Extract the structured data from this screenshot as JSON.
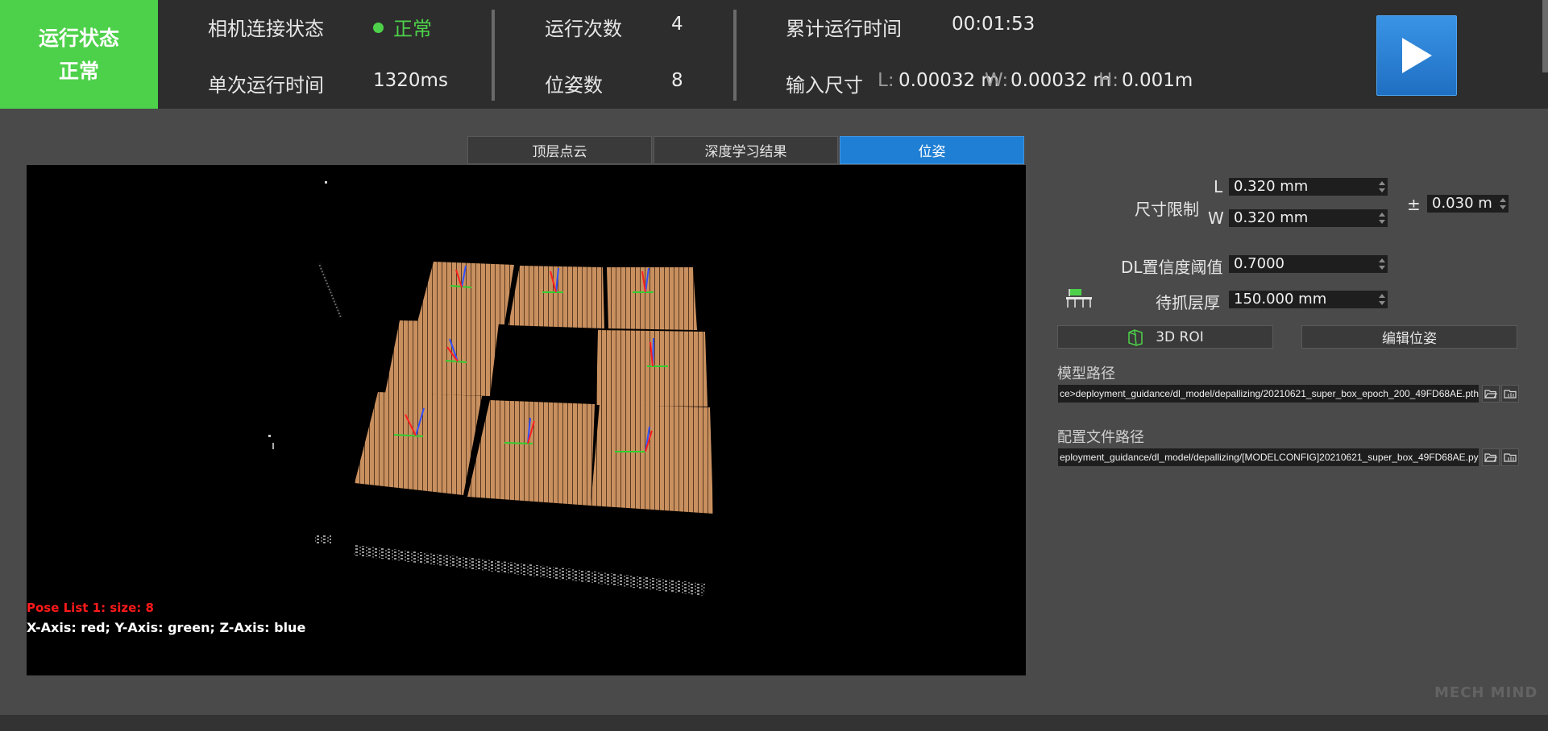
{
  "status": {
    "line1": "运行状态",
    "line2": "正常",
    "color": "#4ed14a"
  },
  "topbar": {
    "camera_label": "相机连接状态",
    "camera_value": "正常",
    "single_run_label": "单次运行时间",
    "single_run_value": "1320ms",
    "run_count_label": "运行次数",
    "run_count_value": "4",
    "pose_count_label": "位姿数",
    "pose_count_value": "8",
    "cum_time_label": "累计运行时间",
    "cum_time_value": "00:01:53",
    "input_size_label": "输入尺寸",
    "size_L_label": "L:",
    "size_L_value": "0.00032 m",
    "size_W_label": "W:",
    "size_W_value": "0.00032 m",
    "size_H_label": "H:",
    "size_H_value": "0.001m",
    "play_icon": "play-icon"
  },
  "tabs": [
    {
      "label": "顶层点云",
      "active": false
    },
    {
      "label": "深度学习结果",
      "active": false
    },
    {
      "label": "位姿",
      "active": true
    }
  ],
  "viewer": {
    "pose_list_text": "Pose List 1: size: 8",
    "axis_legend": "X-Axis: red; Y-Axis: green; Z-Axis: blue"
  },
  "panel": {
    "size_limit_label": "尺寸限制",
    "L_label": "L",
    "L_value": "0.320 mm",
    "W_label": "W",
    "W_value": "0.320 mm",
    "pm_label": "±",
    "tolerance_value": "0.030 m",
    "dl_conf_label": "DL置信度阈值",
    "dl_conf_value": "0.7000",
    "layer_label": "待抓层厚",
    "layer_value": "150.000 mm",
    "roi_button": "3D ROI",
    "edit_pose_button": "编辑位姿",
    "model_path_label": "模型路径",
    "model_path_value": "ce>deployment_guidance/dl_model/depallizing/20210621_super_box_epoch_200_49FD68AE.pth",
    "config_path_label": "配置文件路径",
    "config_path_value": "eployment_guidance/dl_model/depallizing/[MODELCONFIG]20210621_super_box_49FD68AE.py"
  },
  "watermark": "MECH MIND"
}
